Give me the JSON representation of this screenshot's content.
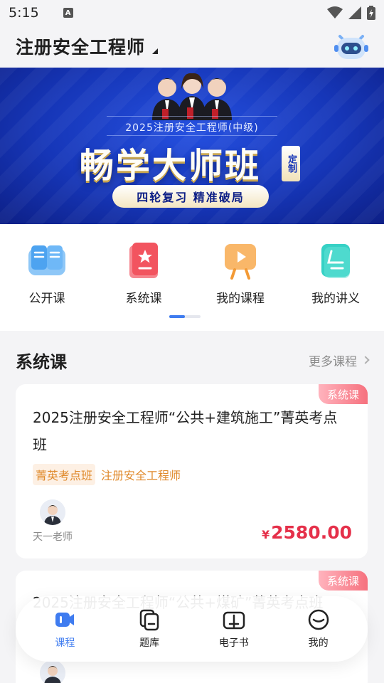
{
  "status_bar": {
    "time": "5:15",
    "notification_icon": "A"
  },
  "header": {
    "title": "注册安全工程师"
  },
  "banner": {
    "subtitle": "2025注册安全工程师(中级)",
    "title": "畅学大师班",
    "tag": "定制",
    "pill": "四轮复习  精准破局"
  },
  "quick_nav": [
    {
      "label": "公开课",
      "icon": "open-book-icon"
    },
    {
      "label": "系统课",
      "icon": "system-course-icon"
    },
    {
      "label": "我的课程",
      "icon": "play-video-icon"
    },
    {
      "label": "我的讲义",
      "icon": "notes-icon"
    }
  ],
  "section": {
    "title": "系统课",
    "more": "更多课程"
  },
  "courses": [
    {
      "badge": "系统课",
      "title": "2025注册安全工程师“公共+建筑施工”菁英考点班",
      "tag_primary": "菁英考点班",
      "tag_secondary": "注册安全工程师",
      "teacher": "天一老师",
      "price_symbol": "¥",
      "price": "2580.00"
    },
    {
      "badge": "系统课",
      "title": "2025注册安全工程师“公共+煤矿”菁英考点班"
    }
  ],
  "bottom_nav": [
    {
      "label": "课程",
      "active": true
    },
    {
      "label": "题库",
      "active": false
    },
    {
      "label": "电子书",
      "active": false
    },
    {
      "label": "我的",
      "active": false
    }
  ],
  "colors": {
    "accent": "#3f7cf0",
    "price": "#e5304a",
    "tag": "#e08a2c",
    "banner": "#1636b8"
  }
}
